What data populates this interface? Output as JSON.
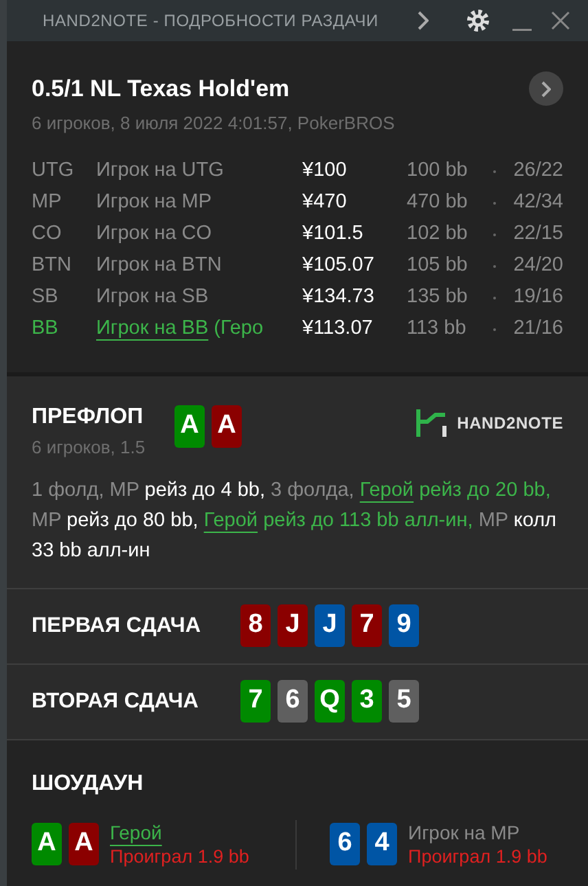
{
  "window": {
    "title": "HAND2NOTE - ПОДРОБНОСТИ РАЗДАЧИ"
  },
  "hand": {
    "title": "0.5/1 NL Texas Hold'em",
    "subtitle": "6 игроков, 8 июля 2022 4:01:57, PokerBROS"
  },
  "players": [
    {
      "position": "UTG",
      "name": "Игрок на UTG",
      "stack": "¥100",
      "bb": "100 bb",
      "stats": "26/22",
      "hero": false
    },
    {
      "position": "MP",
      "name": "Игрок на MP",
      "stack": "¥470",
      "bb": "470 bb",
      "stats": "42/34",
      "hero": false
    },
    {
      "position": "CO",
      "name": "Игрок на CO",
      "stack": "¥101.5",
      "bb": "102 bb",
      "stats": "22/15",
      "hero": false
    },
    {
      "position": "BTN",
      "name": "Игрок на BTN",
      "stack": "¥105.07",
      "bb": "105 bb",
      "stats": "24/20",
      "hero": false
    },
    {
      "position": "SB",
      "name": "Игрок на SB",
      "stack": "¥134.73",
      "bb": "135 bb",
      "stats": "19/16",
      "hero": false
    },
    {
      "position": "BB",
      "name": "Игрок на BB",
      "note": "(Геро",
      "stack": "¥113.07",
      "bb": "113 bb",
      "stats": "21/16",
      "hero": true
    }
  ],
  "preflop": {
    "title": "ПРЕФЛОП",
    "subtitle": "6 игроков, 1.5",
    "cards": [
      {
        "rank": "A",
        "color": "#008a00"
      },
      {
        "rank": "A",
        "color": "#8b0000"
      }
    ],
    "logo": "HAND2NOTE",
    "actions": [
      {
        "kind": "muted",
        "text": "1 фолд, MP"
      },
      {
        "kind": "action",
        "text": "рейз до 4 bb,"
      },
      {
        "kind": "muted",
        "text": "3 фолда,"
      },
      {
        "kind": "hero",
        "text": "Герой"
      },
      {
        "kind": "hero-action",
        "text": "рейз до 20 bb,"
      },
      {
        "kind": "muted",
        "text": "MP"
      },
      {
        "kind": "action",
        "text": "рейз до 80 bb,"
      },
      {
        "kind": "hero",
        "text": "Герой"
      },
      {
        "kind": "hero-action",
        "text": "рейз до 113 bb алл-ин,"
      },
      {
        "kind": "muted",
        "text": "MP"
      },
      {
        "kind": "action",
        "text": "колл 33 bb алл-ин"
      }
    ]
  },
  "boards": [
    {
      "title": "ПЕРВАЯ СДАЧА",
      "cards": [
        {
          "rank": "8",
          "color": "#8b0000"
        },
        {
          "rank": "J",
          "color": "#8b0000"
        },
        {
          "rank": "J",
          "color": "#0055a5"
        },
        {
          "rank": "7",
          "color": "#8b0000"
        },
        {
          "rank": "9",
          "color": "#0055a5"
        }
      ]
    },
    {
      "title": "ВТОРАЯ СДАЧА",
      "cards": [
        {
          "rank": "7",
          "color": "#008a00"
        },
        {
          "rank": "6",
          "color": "#5f5f5f"
        },
        {
          "rank": "Q",
          "color": "#008a00"
        },
        {
          "rank": "3",
          "color": "#008a00"
        },
        {
          "rank": "5",
          "color": "#5f5f5f"
        }
      ]
    }
  ],
  "showdown": {
    "title": "ШОУДАУН",
    "hands": [
      {
        "name": "Герой",
        "hero": true,
        "result": "Проиграл 1.9 bb",
        "cards": [
          {
            "rank": "A",
            "color": "#008a00"
          },
          {
            "rank": "A",
            "color": "#8b0000"
          }
        ]
      },
      {
        "name": "Игрок на MP",
        "hero": false,
        "result": "Проиграл 1.9 bb",
        "cards": [
          {
            "rank": "6",
            "color": "#0055a5"
          },
          {
            "rank": "4",
            "color": "#0055a5"
          }
        ]
      }
    ]
  }
}
